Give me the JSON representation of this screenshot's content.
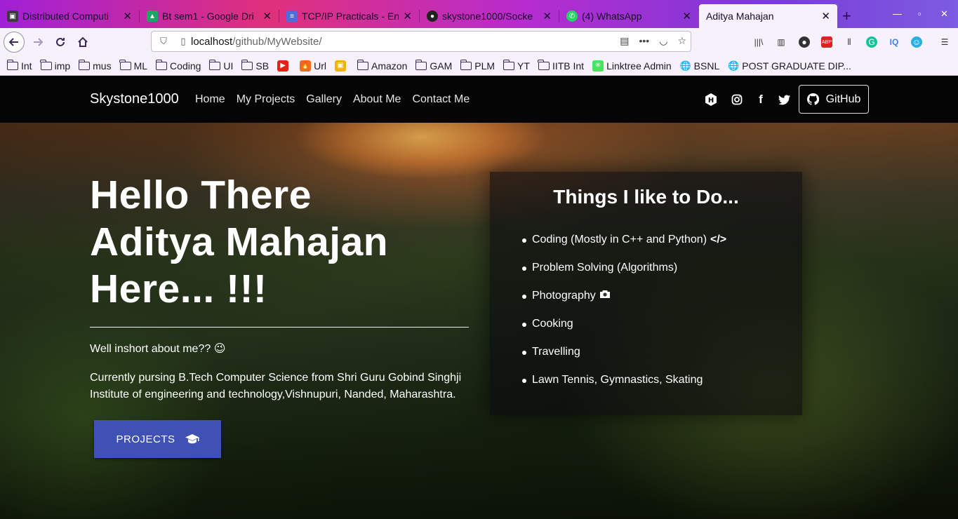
{
  "browser": {
    "tabs": [
      {
        "title": "Distributed Computi",
        "icon": "classroom-icon",
        "color": "#3b3b3b"
      },
      {
        "title": "Bt sem1 - Google Dri",
        "icon": "google-drive-icon",
        "color": "#1fa463"
      },
      {
        "title": "TCP/IP Practicals - En",
        "icon": "docs-icon",
        "color": "#4a6ee0"
      },
      {
        "title": "skystone1000/Socke",
        "icon": "github-icon",
        "color": "#222222"
      },
      {
        "title": "(4) WhatsApp",
        "icon": "whatsapp-icon",
        "color": "#25d366"
      },
      {
        "title": "Aditya Mahajan",
        "icon": "none",
        "color": "#ffffff"
      }
    ],
    "url_host": "localhost",
    "url_path": "/github/MyWebsite/",
    "bookmarks": [
      {
        "label": "Int",
        "type": "folder"
      },
      {
        "label": "imp",
        "type": "folder"
      },
      {
        "label": "mus",
        "type": "folder"
      },
      {
        "label": "ML",
        "type": "folder"
      },
      {
        "label": "Coding",
        "type": "folder"
      },
      {
        "label": "UI",
        "type": "folder"
      },
      {
        "label": "SB",
        "type": "folder"
      },
      {
        "label": "",
        "type": "youtube"
      },
      {
        "label": "Url",
        "type": "fire"
      },
      {
        "label": "",
        "type": "photo"
      },
      {
        "label": "Amazon",
        "type": "folder"
      },
      {
        "label": "GAM",
        "type": "folder"
      },
      {
        "label": "PLM",
        "type": "folder"
      },
      {
        "label": "YT",
        "type": "folder"
      },
      {
        "label": "IITB Int",
        "type": "folder"
      },
      {
        "label": "Linktree Admin",
        "type": "linktree"
      },
      {
        "label": "BSNL",
        "type": "globe"
      },
      {
        "label": "POST GRADUATE DIP...",
        "type": "globe"
      }
    ]
  },
  "site": {
    "brand": "Skystone1000",
    "menu": [
      "Home",
      "My Projects",
      "Gallery",
      "About Me",
      "Contact Me"
    ],
    "github_label": "GitHub",
    "hero": {
      "title_lines": [
        "Hello There",
        "Aditya Mahajan",
        "Here... !!!"
      ],
      "lead": "Well inshort about me?? 😉",
      "text": "Currently pursing B.Tech Computer Science from Shri Guru Gobind Singhji Institute of engineering and technology,Vishnupuri, Nanded, Maharashtra.",
      "button": "PROJECTS"
    },
    "card": {
      "title": "Things I like to Do...",
      "items": [
        "Coding (Mostly in C++ and Python)",
        "Problem Solving (Algorithms)",
        "Photography",
        "Cooking",
        "Travelling",
        "Lawn Tennis, Gymnastics, Skating"
      ],
      "item_icons": [
        "code-icon",
        "",
        "camera-icon",
        "",
        "",
        ""
      ]
    },
    "colors": {
      "button": "#3f51b5",
      "nav_bg": "#050505"
    }
  }
}
